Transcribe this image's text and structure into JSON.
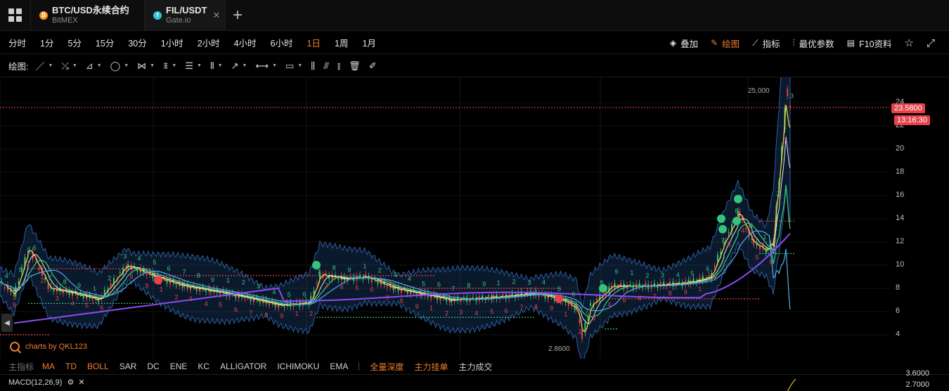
{
  "tabs": [
    {
      "title": "BTC/USD永续合约",
      "sub": "BitMEX",
      "icon": "btc-coin-icon",
      "icon_glyph": "₿"
    },
    {
      "title": "FIL/USDT",
      "sub": "Gate.io",
      "icon": "fil-coin-icon",
      "icon_glyph": "f",
      "close": "✕"
    }
  ],
  "add_tab": "+",
  "timeframes": [
    "分时",
    "1分",
    "5分",
    "15分",
    "30分",
    "1小时",
    "2小时",
    "4小时",
    "6小时",
    "1日",
    "1周",
    "1月"
  ],
  "active_timeframe": "1日",
  "right_tools": [
    {
      "label": "叠加",
      "icon": "layers-icon",
      "glyph": "◈",
      "active": false
    },
    {
      "label": "绘图",
      "icon": "pen-icon",
      "glyph": "✎",
      "active": true
    },
    {
      "label": "指标",
      "icon": "line-chart-icon",
      "glyph": "⟋",
      "active": false
    },
    {
      "label": "最优参数",
      "icon": "sliders-icon",
      "glyph": "⫶",
      "active": false
    },
    {
      "label": "F10资料",
      "icon": "doc-icon",
      "glyph": "▤",
      "active": false
    }
  ],
  "star_glyph": "☆",
  "fullscreen_glyph": "⤢",
  "draw_label": "绘图:",
  "draw_tools": [
    {
      "name": "line-tool",
      "glyph": "／",
      "caret": true
    },
    {
      "name": "ray-tool",
      "glyph": "⤯",
      "caret": true
    },
    {
      "name": "channel-tool",
      "glyph": "⊿",
      "caret": true
    },
    {
      "name": "circle-tool",
      "glyph": "◯",
      "caret": true
    },
    {
      "name": "wave-tool",
      "glyph": "⋈",
      "caret": true
    },
    {
      "name": "pattern-tool",
      "glyph": "⩨",
      "caret": true
    },
    {
      "name": "fib-tool",
      "glyph": "☰",
      "caret": true
    },
    {
      "name": "gann-tool",
      "glyph": "⦀",
      "caret": true
    },
    {
      "name": "arrow-tool",
      "glyph": "↗",
      "caret": true
    },
    {
      "name": "range-tool",
      "glyph": "⟷",
      "caret": true
    },
    {
      "name": "comment-tool",
      "glyph": "▭",
      "caret": true
    },
    {
      "name": "long-tool",
      "glyph": "⫼",
      "caret": false
    },
    {
      "name": "short-tool",
      "glyph": "⫻",
      "caret": false
    },
    {
      "name": "bars-tool",
      "glyph": "⫾",
      "caret": false
    },
    {
      "name": "trash-tool",
      "glyph": "🗑",
      "caret": false
    },
    {
      "name": "magic-tool",
      "glyph": "✐",
      "caret": false
    }
  ],
  "chart": {
    "price_ticks": [
      "24",
      "22",
      "20",
      "18",
      "16",
      "14",
      "12",
      "10",
      "8",
      "6",
      "4"
    ],
    "current_price": "23.5800",
    "countdown": "13:16:30",
    "high_annot": "25.000",
    "low_annot": "2.8600",
    "watermark": "charts by QKL123",
    "scroll_glyph": "◀"
  },
  "indicator_bar": {
    "label": "主指标",
    "items": [
      "MA",
      "TD",
      "BOLL",
      "SAR",
      "DC",
      "ENE",
      "KC",
      "ALLIGATOR",
      "ICHIMOKU",
      "EMA"
    ],
    "orange_items": [
      "MA",
      "TD",
      "BOLL"
    ],
    "extras": [
      "全量深度",
      "主力挂单",
      "主力成交"
    ],
    "extras_orange": [
      "全量深度",
      "主力挂单"
    ]
  },
  "macd": {
    "label": "MACD(12,26,9)",
    "gear_glyph": "⚙",
    "close_glyph": "✕",
    "price_high": "3.6000",
    "price_low": "2.7000"
  },
  "colors": {
    "accent": "#f07d2e",
    "up": "#35c47a",
    "down": "#e8414c",
    "ma_purple": "#8a4df2"
  }
}
